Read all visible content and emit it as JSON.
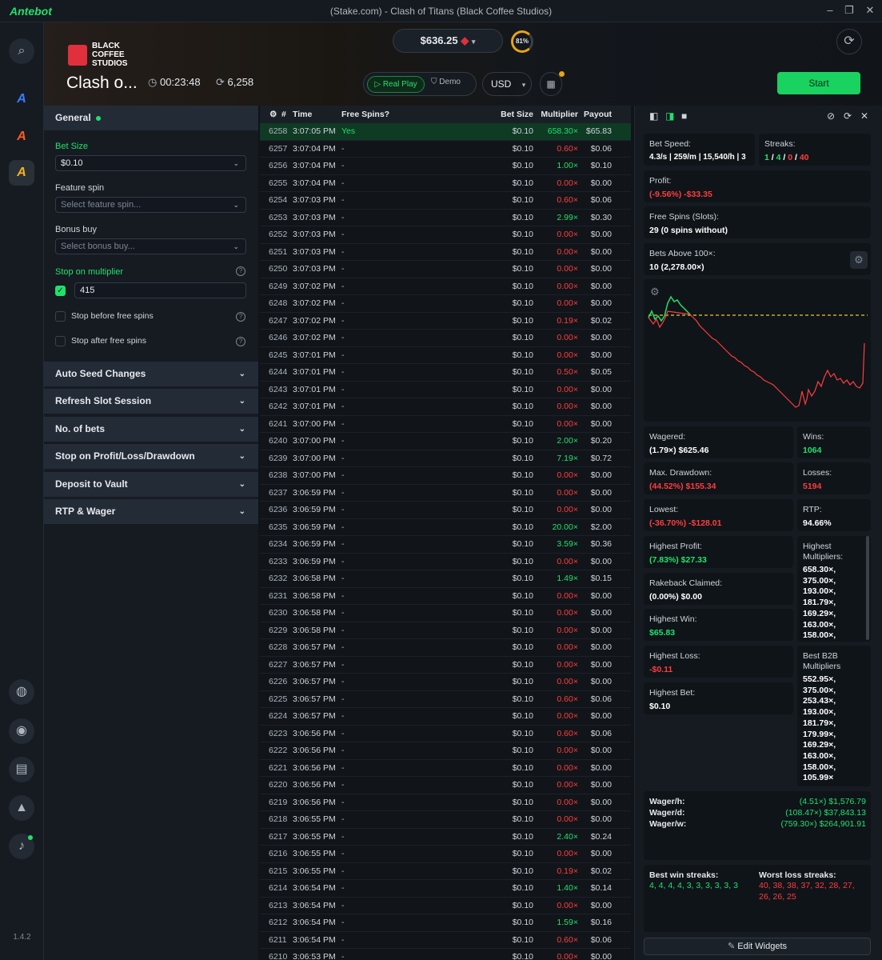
{
  "app": {
    "logo": "Antebot",
    "window_title": "(Stake.com) - Clash of Titans (Black Coffee Studios)",
    "version": "1.4.2"
  },
  "header": {
    "brand_line1": "BLACK",
    "brand_line2": "COFFEE",
    "brand_line3": "STUDIOS",
    "game_title": "Clash o...",
    "timer": "00:23:48",
    "spins": "6,258",
    "balance": "$636.25",
    "ring_pct": "81%",
    "mode_real": "Real Play",
    "mode_demo": "Demo",
    "currency": "USD",
    "start": "Start"
  },
  "left": {
    "general": "General",
    "bet_size_label": "Bet Size",
    "bet_size_value": "$0.10",
    "feature_spin_label": "Feature spin",
    "feature_spin_placeholder": "Select feature spin...",
    "bonus_buy_label": "Bonus buy",
    "bonus_buy_placeholder": "Select bonus buy...",
    "stop_multiplier_label": "Stop on multiplier",
    "stop_multiplier_value": "415",
    "stop_before": "Stop before free spins",
    "stop_after": "Stop after free spins",
    "sections": [
      "Auto Seed Changes",
      "Refresh Slot Session",
      "No. of bets",
      "Stop on Profit/Loss/Drawdown",
      "Deposit to Vault",
      "RTP & Wager"
    ]
  },
  "table": {
    "headers": {
      "num": "#",
      "time": "Time",
      "fs": "Free Spins?",
      "bet": "Bet Size",
      "mul": "Multiplier",
      "pay": "Payout"
    },
    "rows": [
      [
        "6258",
        "3:07:05 PM",
        "Yes",
        "$0.10",
        "658.30×",
        "$65.83",
        "g"
      ],
      [
        "6257",
        "3:07:04 PM",
        "-",
        "$0.10",
        "0.60×",
        "$0.06",
        "r"
      ],
      [
        "6256",
        "3:07:04 PM",
        "-",
        "$0.10",
        "1.00×",
        "$0.10",
        "g"
      ],
      [
        "6255",
        "3:07:04 PM",
        "-",
        "$0.10",
        "0.00×",
        "$0.00",
        "r"
      ],
      [
        "6254",
        "3:07:03 PM",
        "-",
        "$0.10",
        "0.60×",
        "$0.06",
        "r"
      ],
      [
        "6253",
        "3:07:03 PM",
        "-",
        "$0.10",
        "2.99×",
        "$0.30",
        "g"
      ],
      [
        "6252",
        "3:07:03 PM",
        "-",
        "$0.10",
        "0.00×",
        "$0.00",
        "r"
      ],
      [
        "6251",
        "3:07:03 PM",
        "-",
        "$0.10",
        "0.00×",
        "$0.00",
        "r"
      ],
      [
        "6250",
        "3:07:03 PM",
        "-",
        "$0.10",
        "0.00×",
        "$0.00",
        "r"
      ],
      [
        "6249",
        "3:07:02 PM",
        "-",
        "$0.10",
        "0.00×",
        "$0.00",
        "r"
      ],
      [
        "6248",
        "3:07:02 PM",
        "-",
        "$0.10",
        "0.00×",
        "$0.00",
        "r"
      ],
      [
        "6247",
        "3:07:02 PM",
        "-",
        "$0.10",
        "0.19×",
        "$0.02",
        "r"
      ],
      [
        "6246",
        "3:07:02 PM",
        "-",
        "$0.10",
        "0.00×",
        "$0.00",
        "r"
      ],
      [
        "6245",
        "3:07:01 PM",
        "-",
        "$0.10",
        "0.00×",
        "$0.00",
        "r"
      ],
      [
        "6244",
        "3:07:01 PM",
        "-",
        "$0.10",
        "0.50×",
        "$0.05",
        "r"
      ],
      [
        "6243",
        "3:07:01 PM",
        "-",
        "$0.10",
        "0.00×",
        "$0.00",
        "r"
      ],
      [
        "6242",
        "3:07:01 PM",
        "-",
        "$0.10",
        "0.00×",
        "$0.00",
        "r"
      ],
      [
        "6241",
        "3:07:00 PM",
        "-",
        "$0.10",
        "0.00×",
        "$0.00",
        "r"
      ],
      [
        "6240",
        "3:07:00 PM",
        "-",
        "$0.10",
        "2.00×",
        "$0.20",
        "g"
      ],
      [
        "6239",
        "3:07:00 PM",
        "-",
        "$0.10",
        "7.19×",
        "$0.72",
        "g"
      ],
      [
        "6238",
        "3:07:00 PM",
        "-",
        "$0.10",
        "0.00×",
        "$0.00",
        "r"
      ],
      [
        "6237",
        "3:06:59 PM",
        "-",
        "$0.10",
        "0.00×",
        "$0.00",
        "r"
      ],
      [
        "6236",
        "3:06:59 PM",
        "-",
        "$0.10",
        "0.00×",
        "$0.00",
        "r"
      ],
      [
        "6235",
        "3:06:59 PM",
        "-",
        "$0.10",
        "20.00×",
        "$2.00",
        "g"
      ],
      [
        "6234",
        "3:06:59 PM",
        "-",
        "$0.10",
        "3.59×",
        "$0.36",
        "g"
      ],
      [
        "6233",
        "3:06:59 PM",
        "-",
        "$0.10",
        "0.00×",
        "$0.00",
        "r"
      ],
      [
        "6232",
        "3:06:58 PM",
        "-",
        "$0.10",
        "1.49×",
        "$0.15",
        "g"
      ],
      [
        "6231",
        "3:06:58 PM",
        "-",
        "$0.10",
        "0.00×",
        "$0.00",
        "r"
      ],
      [
        "6230",
        "3:06:58 PM",
        "-",
        "$0.10",
        "0.00×",
        "$0.00",
        "r"
      ],
      [
        "6229",
        "3:06:58 PM",
        "-",
        "$0.10",
        "0.00×",
        "$0.00",
        "r"
      ],
      [
        "6228",
        "3:06:57 PM",
        "-",
        "$0.10",
        "0.00×",
        "$0.00",
        "r"
      ],
      [
        "6227",
        "3:06:57 PM",
        "-",
        "$0.10",
        "0.00×",
        "$0.00",
        "r"
      ],
      [
        "6226",
        "3:06:57 PM",
        "-",
        "$0.10",
        "0.00×",
        "$0.00",
        "r"
      ],
      [
        "6225",
        "3:06:57 PM",
        "-",
        "$0.10",
        "0.60×",
        "$0.06",
        "r"
      ],
      [
        "6224",
        "3:06:57 PM",
        "-",
        "$0.10",
        "0.00×",
        "$0.00",
        "r"
      ],
      [
        "6223",
        "3:06:56 PM",
        "-",
        "$0.10",
        "0.60×",
        "$0.06",
        "r"
      ],
      [
        "6222",
        "3:06:56 PM",
        "-",
        "$0.10",
        "0.00×",
        "$0.00",
        "r"
      ],
      [
        "6221",
        "3:06:56 PM",
        "-",
        "$0.10",
        "0.00×",
        "$0.00",
        "r"
      ],
      [
        "6220",
        "3:06:56 PM",
        "-",
        "$0.10",
        "0.00×",
        "$0.00",
        "r"
      ],
      [
        "6219",
        "3:06:56 PM",
        "-",
        "$0.10",
        "0.00×",
        "$0.00",
        "r"
      ],
      [
        "6218",
        "3:06:55 PM",
        "-",
        "$0.10",
        "0.00×",
        "$0.00",
        "r"
      ],
      [
        "6217",
        "3:06:55 PM",
        "-",
        "$0.10",
        "2.40×",
        "$0.24",
        "g"
      ],
      [
        "6216",
        "3:06:55 PM",
        "-",
        "$0.10",
        "0.00×",
        "$0.00",
        "r"
      ],
      [
        "6215",
        "3:06:55 PM",
        "-",
        "$0.10",
        "0.19×",
        "$0.02",
        "r"
      ],
      [
        "6214",
        "3:06:54 PM",
        "-",
        "$0.10",
        "1.40×",
        "$0.14",
        "g"
      ],
      [
        "6213",
        "3:06:54 PM",
        "-",
        "$0.10",
        "0.00×",
        "$0.00",
        "r"
      ],
      [
        "6212",
        "3:06:54 PM",
        "-",
        "$0.10",
        "1.59×",
        "$0.16",
        "g"
      ],
      [
        "6211",
        "3:06:54 PM",
        "-",
        "$0.10",
        "0.60×",
        "$0.06",
        "r"
      ],
      [
        "6210",
        "3:06:53 PM",
        "-",
        "$0.10",
        "0.00×",
        "$0.00",
        "r"
      ]
    ]
  },
  "stats": {
    "bet_speed_t": "Bet Speed:",
    "bet_speed_v": "4.3/s | 259/m | 15,540/h | 3",
    "streaks_t": "Streaks:",
    "streaks_v1": "1",
    "streaks_v2": "4",
    "streaks_v3": "0",
    "streaks_v4": "40",
    "profit_t": "Profit:",
    "profit_v": "(-9.56%) -$33.35",
    "free_spins_t": "Free Spins (Slots):",
    "free_spins_v": "29 (0 spins without)",
    "bets_above_t": "Bets Above 100×:",
    "bets_above_v": "10 (2,278.00×)",
    "wagered_t": "Wagered:",
    "wagered_v": "(1.79×) $625.46",
    "wins_t": "Wins:",
    "wins_v": "1064",
    "drawdown_t": "Max. Drawdown:",
    "drawdown_v": "(44.52%) $155.34",
    "losses_t": "Losses:",
    "losses_v": "5194",
    "lowest_t": "Lowest:",
    "lowest_v": "(-36.70%) -$128.01",
    "rtp_t": "RTP:",
    "rtp_v": "94.66%",
    "highest_profit_t": "Highest Profit:",
    "highest_profit_v": "(7.83%) $27.33",
    "highest_mult_t": "Highest Multipliers:",
    "highest_mult_list": [
      "658.30×,",
      "375.00×,",
      "193.00×,",
      "181.79×,",
      "169.29×,",
      "163.00×,",
      "158.00×,"
    ],
    "rakeback_t": "Rakeback Claimed:",
    "rakeback_v": "(0.00%) $0.00",
    "highest_win_t": "Highest Win:",
    "highest_win_v": "$65.83",
    "highest_loss_t": "Highest Loss:",
    "highest_loss_v": "-$0.11",
    "best_b2b_t": "Best B2B Multipliers",
    "best_b2b_list": [
      "552.95×,",
      "375.00×,",
      "253.43×,",
      "193.00×,",
      "181.79×,",
      "179.99×,",
      "169.29×,",
      "163.00×,",
      "158.00×,",
      "105.99×"
    ],
    "highest_bet_t": "Highest Bet:",
    "highest_bet_v": "$0.10",
    "wager_h_k": "Wager/h:",
    "wager_h_v": "(4.51×) $1,576.79",
    "wager_d_k": "Wager/d:",
    "wager_d_v": "(108.47×) $37,843.13",
    "wager_w_k": "Wager/w:",
    "wager_w_v": "(759.30×) $264,901.91",
    "best_streaks_t": "Best win streaks:",
    "best_streaks_v": "4, 4, 4, 4, 3, 3, 3, 3, 3, 3",
    "worst_streaks_t": "Worst loss streaks:",
    "worst_streaks_v1": "40, 38, 38, 37, 32, 28, 27,",
    "worst_streaks_v2": "26, 26, 25",
    "edit_widgets": "Edit Widgets"
  },
  "colors": {
    "accent": "#22e06b",
    "loss": "#ff3d3d",
    "warn": "#e8a317"
  }
}
